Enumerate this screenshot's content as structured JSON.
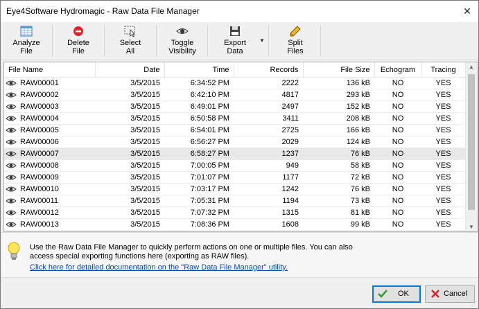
{
  "window": {
    "title": "Eye4Software Hydromagic - Raw Data  File Manager"
  },
  "toolbar": {
    "analyze": [
      "Analyze",
      "File"
    ],
    "delete": [
      "Delete",
      "File"
    ],
    "select_all": [
      "Select",
      "All"
    ],
    "toggle": [
      "Toggle",
      "Visibility"
    ],
    "export": [
      "Export",
      "Data"
    ],
    "split": [
      "Split",
      "Files"
    ]
  },
  "table": {
    "headers": [
      "File Name",
      "Date",
      "Time",
      "Records",
      "File Size",
      "Echogram",
      "Tracing"
    ],
    "selected_row": 6,
    "rows": [
      [
        "RAW00001",
        "3/5/2015",
        "6:34:52 PM",
        "2222",
        "136 kB",
        "NO",
        "YES"
      ],
      [
        "RAW00002",
        "3/5/2015",
        "6:42:10 PM",
        "4817",
        "293 kB",
        "NO",
        "YES"
      ],
      [
        "RAW00003",
        "3/5/2015",
        "6:49:01 PM",
        "2497",
        "152 kB",
        "NO",
        "YES"
      ],
      [
        "RAW00004",
        "3/5/2015",
        "6:50:58 PM",
        "3411",
        "208 kB",
        "NO",
        "YES"
      ],
      [
        "RAW00005",
        "3/5/2015",
        "6:54:01 PM",
        "2725",
        "166 kB",
        "NO",
        "YES"
      ],
      [
        "RAW00006",
        "3/5/2015",
        "6:56:27 PM",
        "2029",
        "124 kB",
        "NO",
        "YES"
      ],
      [
        "RAW00007",
        "3/5/2015",
        "6:58:27 PM",
        "1237",
        "76 kB",
        "NO",
        "YES"
      ],
      [
        "RAW00008",
        "3/5/2015",
        "7:00:05 PM",
        "949",
        "58 kB",
        "NO",
        "YES"
      ],
      [
        "RAW00009",
        "3/5/2015",
        "7:01:07 PM",
        "1177",
        "72 kB",
        "NO",
        "YES"
      ],
      [
        "RAW00010",
        "3/5/2015",
        "7:03:17 PM",
        "1242",
        "76 kB",
        "NO",
        "YES"
      ],
      [
        "RAW00011",
        "3/5/2015",
        "7:05:31 PM",
        "1194",
        "73 kB",
        "NO",
        "YES"
      ],
      [
        "RAW00012",
        "3/5/2015",
        "7:07:32 PM",
        "1315",
        "81 kB",
        "NO",
        "YES"
      ],
      [
        "RAW00013",
        "3/5/2015",
        "7:08:36 PM",
        "1608",
        "99 kB",
        "NO",
        "YES"
      ]
    ]
  },
  "info": {
    "line1": "Use the Raw Data File Manager to quickly perform actions on one or multiple files. You can also",
    "line2": "access special exporting functions here (exporting as RAW files).",
    "link": "Click here for detailed documentation on the \"Raw Data File Manager\" utility."
  },
  "buttons": {
    "ok": "OK",
    "cancel": "Cancel"
  }
}
